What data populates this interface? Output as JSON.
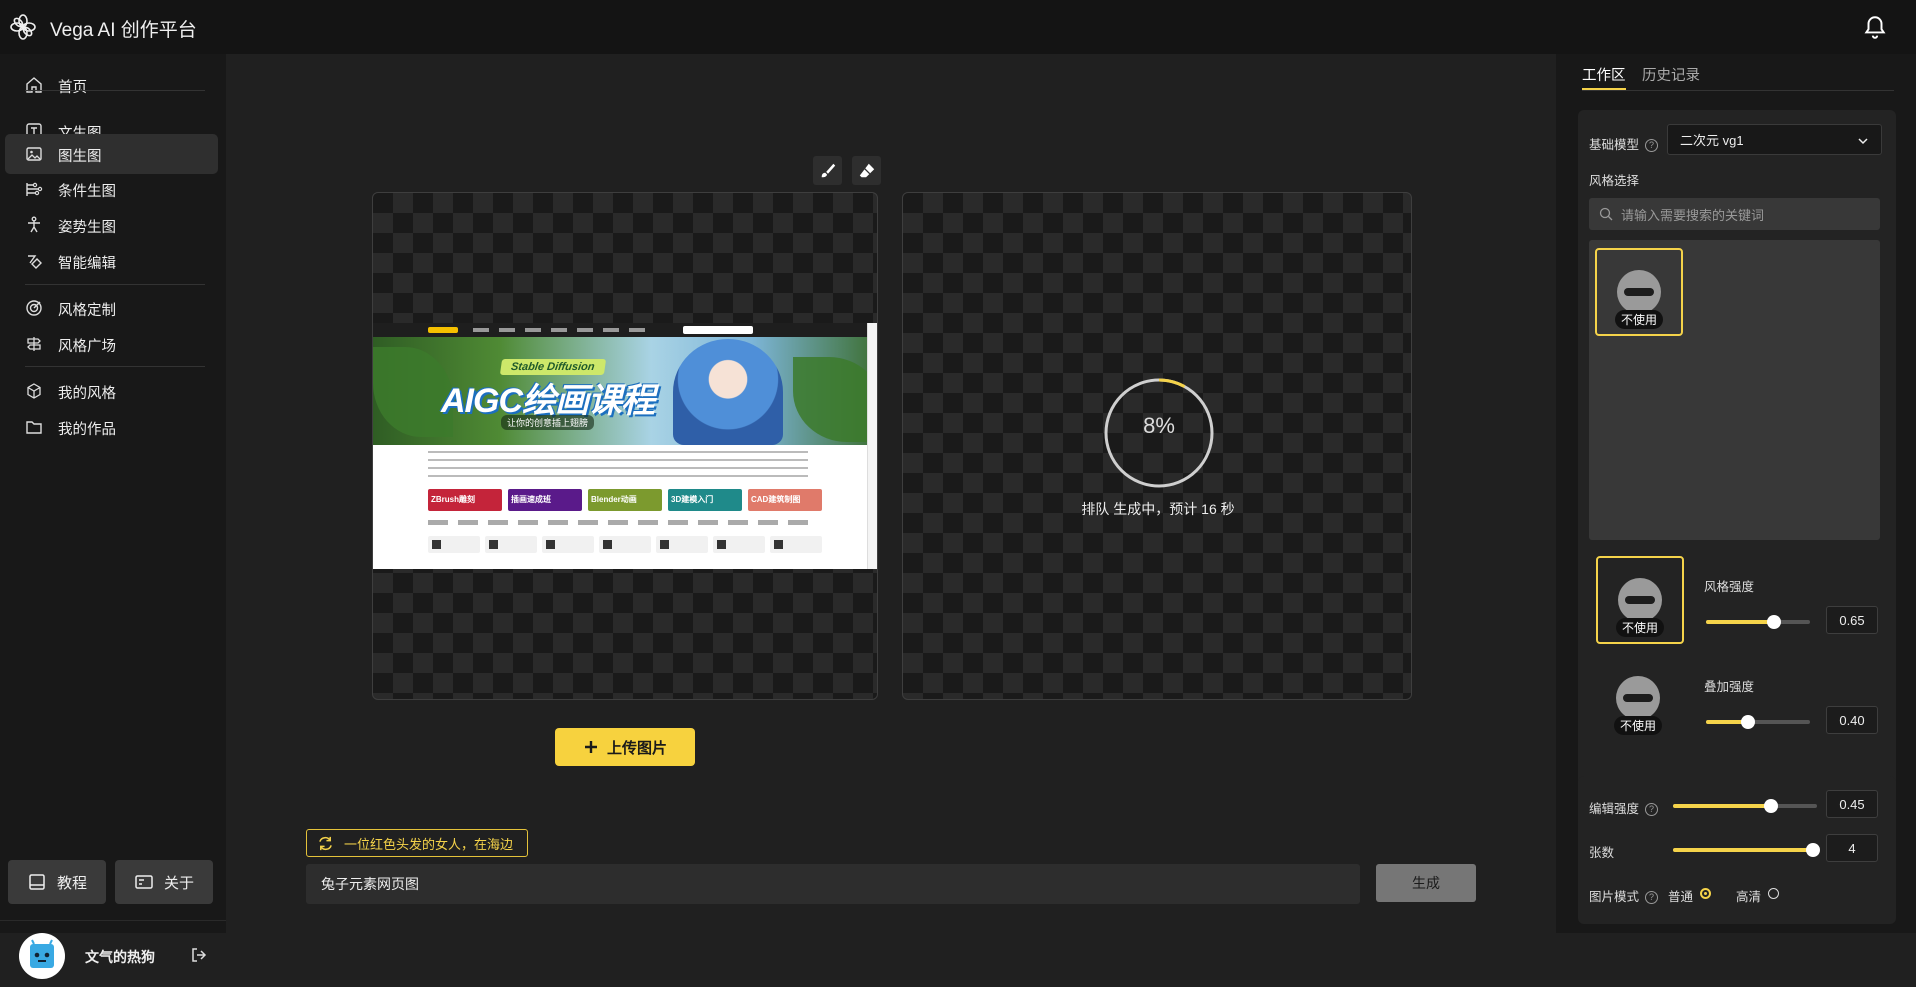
{
  "app": {
    "title": "Vega AI 创作平台"
  },
  "sidebar": {
    "items": [
      {
        "label": "首页",
        "icon": "home-icon"
      },
      {
        "label": "文生图",
        "icon": "text-icon"
      },
      {
        "label": "图生图",
        "icon": "image-icon",
        "active": true
      },
      {
        "label": "条件生图",
        "icon": "condition-icon"
      },
      {
        "label": "姿势生图",
        "icon": "pose-icon"
      },
      {
        "label": "智能编辑",
        "icon": "edit-icon"
      },
      {
        "label": "风格定制",
        "icon": "target-icon"
      },
      {
        "label": "风格广场",
        "icon": "signpost-icon"
      },
      {
        "label": "我的风格",
        "icon": "cube-icon"
      },
      {
        "label": "我的作品",
        "icon": "folder-icon"
      }
    ],
    "tutorial_label": "教程",
    "about_label": "关于",
    "username": "文气的热狗"
  },
  "canvas": {
    "preview": {
      "banner_tag": "Stable Diffusion",
      "banner_title": "AIGC绘画课程",
      "banner_sub": "让你的创意插上翅膀",
      "cards": [
        "ZBrush雕刻",
        "插画速成班",
        "Blender动画",
        "3D建模入门",
        "CAD建筑制图"
      ]
    },
    "progress_text": "8%",
    "progress_value": 0.08,
    "queue_text": "排队 生成中，预计 16 秒",
    "upload_label": "上传图片"
  },
  "prompt": {
    "hint": "一位红色头发的女人，在海边",
    "value": "兔子元素网页图",
    "generate_label": "生成"
  },
  "panel": {
    "tabs": [
      "工作区",
      "历史记录"
    ],
    "base_model_label": "基础模型",
    "base_model_value": "二次元 vg1",
    "style_label": "风格选择",
    "search_placeholder": "请输入需要搜索的关键词",
    "no_use": "不使用",
    "style_strength_label": "风格强度",
    "style_strength": "0.65",
    "overlay_strength_label": "叠加强度",
    "overlay_strength": "0.40",
    "edit_strength_label": "编辑强度",
    "edit_strength": "0.45",
    "count_label": "张数",
    "count": "4",
    "mode_label": "图片模式",
    "mode_options": [
      "普通",
      "高清"
    ],
    "mode_selected": "普通"
  },
  "colors": {
    "accent": "#f5d34a",
    "background": "#202020",
    "sidebar": "#181818"
  }
}
